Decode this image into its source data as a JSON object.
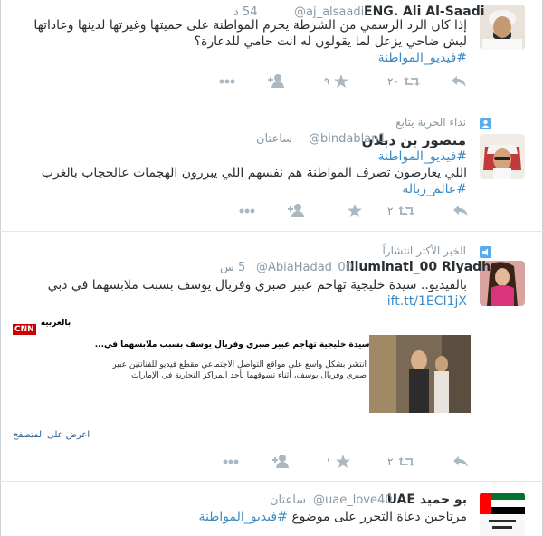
{
  "tweets": [
    {
      "name": "ENG. Ali Al-Saadi",
      "handle": "@aj_alsaadi",
      "time": "54 د",
      "text_lines": [
        "إذا كان الرد الرسمي من الشرطة يجرم المواطنة على حميتها وغيرتها لدينها وعاداتها",
        "ليش ضاحي يزعل لما يقولون له انت حامي للدعارة؟"
      ],
      "hashtag": "#فيديو_المواطنة",
      "retweets": "٢٠",
      "favorites": "٩"
    },
    {
      "context": "نداء الحرية يتابع",
      "name": "منصور بن دبلان",
      "handle": "@bindablan1",
      "time": "ساعتان",
      "hashtag_top": "#فيديو_المواطنة",
      "text": "اللي يعارضون تصرف المواطنة هم نفسهم اللي يبررون الهجمات عالحجاب بالغرب",
      "hashtag_bottom": "#عالم_زبالة",
      "retweets": "٢",
      "favorites": ""
    },
    {
      "context": "الخبر الأكثر انتشاراً",
      "name": "illuminati_00 Riyadh",
      "handle": "@AbiaHadad_00",
      "time": "5 س",
      "text": "بالفيديو.. سيدة خليجية تهاجم عبير صبري وفريال يوسف بسبب ملابسهما في دبي",
      "link": "ift.tt/1ECI1jX",
      "card": {
        "logo_text": "CNN",
        "logo_sub": "بالعربية",
        "title": "بالفيديو.. سيدة خليجية تهاجم عبير صبري وفريال يوسف بسبب ملابسهما في...",
        "description": "انتشر بشكل واسع على مواقع التواصل الاجتماعي مقطع فيديو للفنانتين عبير صبري وفريال يوسف، أثناء تسوقهما بأحد المراكز التجارية في الإمارات",
        "view_label": "اعرض على المتصفح"
      },
      "retweets": "٢",
      "favorites": "١"
    },
    {
      "name": "بو حميد UAE",
      "handle": "@uae_love40",
      "time": "ساعتان",
      "text": "مرتاحين دعاة التحرر على موضوع",
      "hashtag": "#فيديو_المواطنة"
    }
  ],
  "colors": {
    "link": "#3d8ac4",
    "muted": "#8899a6",
    "icon": "#aab8c2"
  }
}
